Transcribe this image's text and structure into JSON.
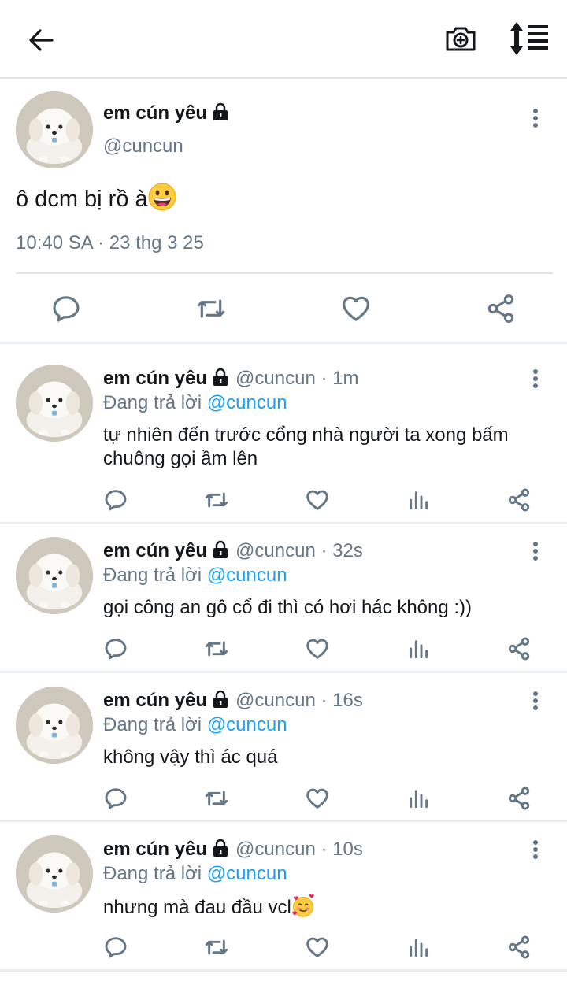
{
  "main": {
    "name": "em cún yêu",
    "handle": "@cuncun",
    "text": "ô dcm bị rồ à",
    "time": "10:40 SA · 23 thg 3 25"
  },
  "replies": [
    {
      "name": "em cún yêu",
      "handle": "@cuncun · 1m",
      "replying_prefix": "Đang trả lời",
      "mention": "@cuncun",
      "text": "tự nhiên đến trước cổng nhà người ta xong bấm chuông gọi ầm lên"
    },
    {
      "name": "em cún yêu",
      "handle": "@cuncun · 32s",
      "replying_prefix": "Đang trả lời",
      "mention": "@cuncun",
      "text": "gọi công an gô cổ đi thì có hơi hác không :))"
    },
    {
      "name": "em cún yêu",
      "handle": "@cuncun · 16s",
      "replying_prefix": "Đang trả lời",
      "mention": "@cuncun",
      "text": "không vậy thì ác quá"
    },
    {
      "name": "em cún yêu",
      "handle": "@cuncun · 10s",
      "replying_prefix": "Đang trả lời",
      "mention": "@cuncun",
      "text": "nhưng mà đau đầu vcl"
    }
  ],
  "icons": {
    "back": "arrow-left-icon",
    "camera": "camera-plus-icon",
    "sort": "sort-lines-icon",
    "lock": "lock-icon",
    "reply": "comment-icon",
    "retweet": "retweet-icon",
    "like": "heart-icon",
    "stats": "bar-chart-icon",
    "share": "share-icon",
    "more": "more-vertical-icon"
  },
  "colors": {
    "text": "#14171a",
    "muted": "#657786",
    "link": "#1da1f2",
    "divider": "#e6ecf0"
  }
}
